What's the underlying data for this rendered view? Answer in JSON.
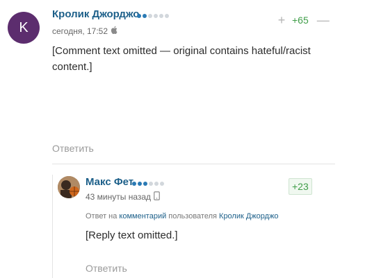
{
  "comments": [
    {
      "avatar_letter": "K",
      "author": "Кролик Джорджо",
      "rating": {
        "filled": 2,
        "total": 6
      },
      "timestamp": "сегодня, 17:52",
      "device_icon": "apple-icon",
      "score": "+65",
      "body": "[Comment text omitted — original contains hateful/racist content.]",
      "reply_label": "Ответить"
    },
    {
      "author": "Макс Фет",
      "rating": {
        "filled": 3,
        "total": 6
      },
      "timestamp": "43 минуты назад",
      "device_icon": "phone-icon",
      "score": "+23",
      "reply_to": {
        "prefix": "Ответ на",
        "link": "комментарий",
        "middle": "пользователя",
        "user": "Кролик Джорджо"
      },
      "body": "[Reply text omitted.]",
      "reply_label": "Ответить"
    }
  ],
  "colors": {
    "author": "#1c5f89",
    "score_positive": "#3f9d48",
    "avatar_bg": "#5c2d6e",
    "dot_on": "#2a7ab4",
    "dot_off": "#d2d7dc"
  }
}
